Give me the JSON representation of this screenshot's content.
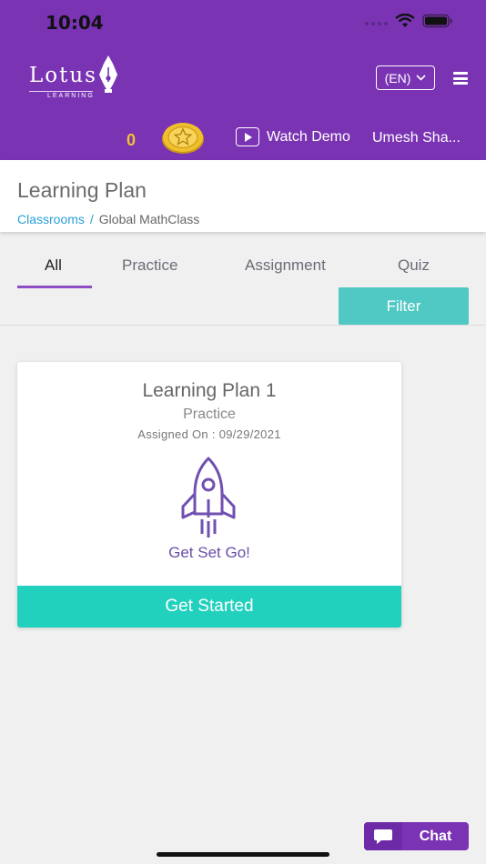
{
  "status": {
    "time": "10:04"
  },
  "header": {
    "logo_text": "Lotus",
    "logo_sub": "LEARNING",
    "lang_label": "(EN)",
    "coins": "0",
    "watch_demo": "Watch Demo",
    "user_name": "Umesh Sha..."
  },
  "page": {
    "title": "Learning Plan",
    "breadcrumb": {
      "root": "Classrooms",
      "separator": "/",
      "current": "Global MathClass"
    }
  },
  "tabs": [
    "All",
    "Practice",
    "Assignment",
    "Quiz"
  ],
  "active_tab": "All",
  "filter_label": "Filter",
  "card": {
    "title": "Learning Plan 1",
    "type": "Practice",
    "assigned": "Assigned On : 09/29/2021",
    "tagline": "Get Set Go!",
    "button": "Get Started"
  },
  "chat_label": "Chat",
  "colors": {
    "header": "#7a34b3",
    "accent": "#22d1bd",
    "filter": "#50c8c4",
    "link": "#2a9fd8"
  }
}
